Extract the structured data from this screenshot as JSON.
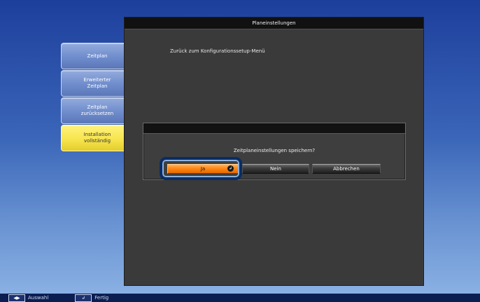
{
  "sidebar": {
    "items": [
      {
        "label": "Zeitplan"
      },
      {
        "label": "Erweiterter\nZeitplan"
      },
      {
        "label": "Zeitplan\nzurücksetzen"
      },
      {
        "label": "Installation\nvollständig"
      }
    ]
  },
  "main": {
    "title": "Planeinstellungen",
    "subtitle": "Zurück zum Konfigurationssetup-Menü"
  },
  "dialog": {
    "message": "Zeitplaneinstellungen speichern?",
    "buttons": {
      "yes": "Ja",
      "no": "Nein",
      "cancel": "Abbrechen"
    }
  },
  "footer": {
    "select_label": "Auswahl",
    "done_label": "Fertig"
  },
  "colors": {
    "accent_orange": "#ff8a1a",
    "active_yellow": "#f6e34a",
    "sidebar_blue": "#6f8ccc"
  }
}
